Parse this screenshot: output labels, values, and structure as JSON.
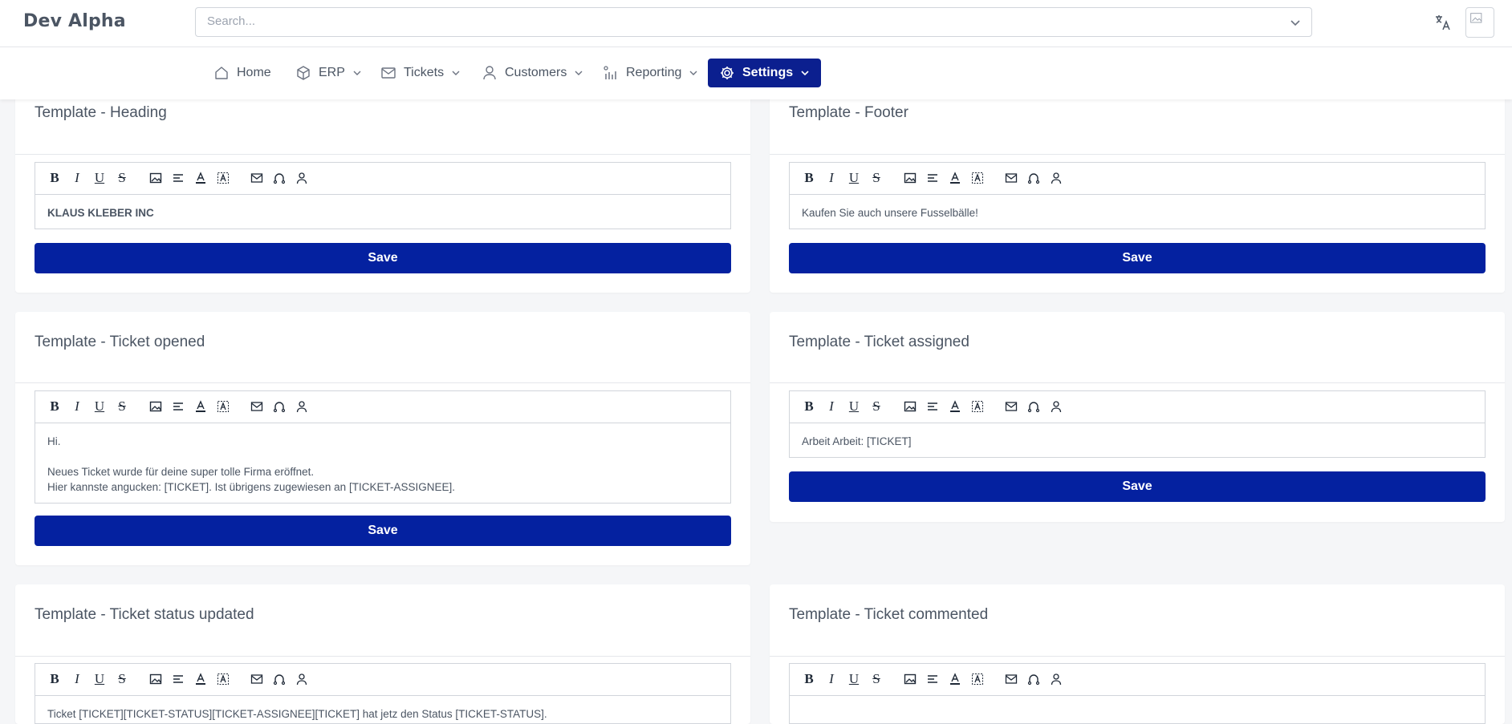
{
  "app": {
    "title": "Dev Alpha"
  },
  "search": {
    "placeholder": "Search..."
  },
  "nav": {
    "items": [
      {
        "label": "Home",
        "icon": "home-icon"
      },
      {
        "label": "ERP",
        "icon": "cube-icon"
      },
      {
        "label": "Tickets",
        "icon": "mail-icon"
      },
      {
        "label": "Customers",
        "icon": "user-icon"
      },
      {
        "label": "Reporting",
        "icon": "chart-icon"
      },
      {
        "label": "Settings",
        "icon": "gear-icon"
      }
    ]
  },
  "colors": {
    "accent": "#0421a0",
    "nav_active": "#0b1f8f"
  },
  "toolbar_icons": [
    "bold-icon",
    "italic-icon",
    "underline-icon",
    "strikethrough-icon",
    "image-icon",
    "align-icon",
    "text-color-icon",
    "clear-format-icon",
    "mail-icon",
    "link-icon",
    "user-icon"
  ],
  "cards": {
    "heading": {
      "title": "Template - Heading",
      "content": [
        "KLAUS KLEBER INC"
      ],
      "save": "Save"
    },
    "footer": {
      "title": "Template - Footer",
      "content": [
        "Kaufen Sie auch unsere Fusselbälle!"
      ],
      "save": "Save"
    },
    "opened": {
      "title": "Template - Ticket opened",
      "content": [
        "Hi.",
        "",
        "Neues Ticket wurde für deine super tolle Firma eröffnet.",
        "Hier kannste angucken: [TICKET]. Ist übrigens zugewiesen an [TICKET-ASSIGNEE]."
      ],
      "save": "Save"
    },
    "assigned": {
      "title": "Template - Ticket assigned",
      "content": [
        "Arbeit Arbeit: [TICKET]"
      ],
      "save": "Save"
    },
    "status": {
      "title": "Template - Ticket status updated",
      "content": [
        "Ticket [TICKET][TICKET-STATUS][TICKET-ASSIGNEE][TICKET] hat jetz den Status [TICKET-STATUS]."
      ]
    },
    "commented": {
      "title": "Template - Ticket commented",
      "content": [
        ""
      ]
    }
  }
}
